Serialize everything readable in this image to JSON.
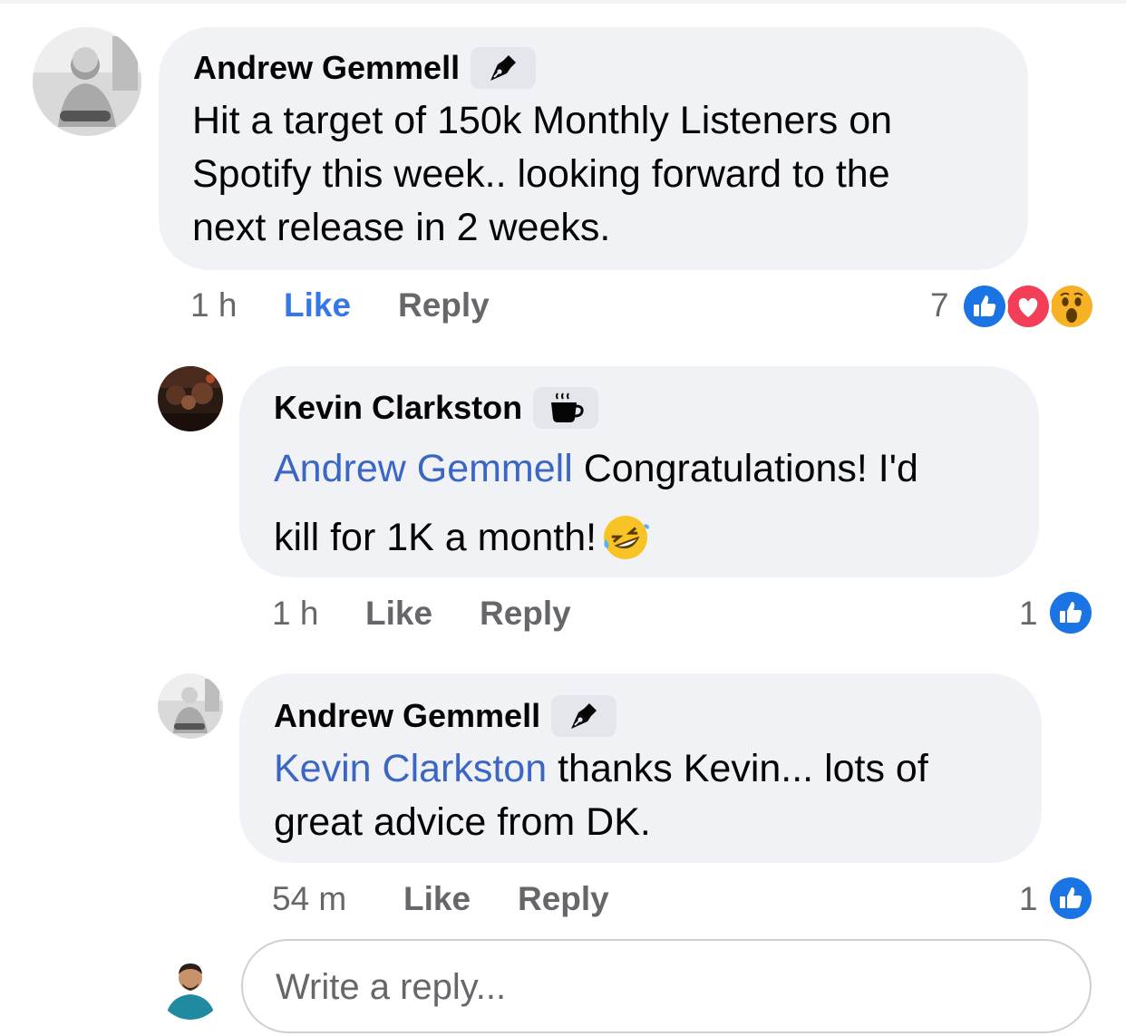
{
  "comments": [
    {
      "author": "Andrew Gemmell",
      "badge_icon": "pen-nib-icon",
      "text_lines": [
        "Hit a target of 150k Monthly Listeners on",
        "Spotify this week.. looking forward to the",
        "next release in 2 weeks."
      ],
      "time": "1 h",
      "like_label": "Like",
      "liked": true,
      "reply_label": "Reply",
      "reaction_count": "7",
      "reactions": [
        "like-reaction-icon",
        "love-reaction-icon",
        "wow-reaction-icon"
      ]
    },
    {
      "author": "Kevin Clarkston",
      "badge_icon": "coffee-cup-icon",
      "mention": "Andrew Gemmell",
      "text_line1": " Congratulations! I'd",
      "text_line2": "kill for 1K a month!",
      "emoji": "🤣",
      "time": "1 h",
      "like_label": "Like",
      "reply_label": "Reply",
      "reaction_count": "1",
      "reactions": [
        "like-reaction-icon"
      ]
    },
    {
      "author": "Andrew Gemmell",
      "badge_icon": "pen-nib-icon",
      "mention": "Kevin Clarkston",
      "text_line1": " thanks Kevin... lots of",
      "text_line2": "great advice from DK.",
      "time": "54 m",
      "like_label": "Like",
      "reply_label": "Reply",
      "reaction_count": "1",
      "reactions": [
        "like-reaction-icon"
      ]
    }
  ],
  "reply_box": {
    "placeholder": "Write a reply..."
  },
  "colors": {
    "bubble": "#f0f2f5",
    "mention": "#3b66c4",
    "like_blue": "#3578e5",
    "meta_gray": "#65676b",
    "love_red": "#f33e58",
    "wow_yellow": "#f7b125"
  }
}
